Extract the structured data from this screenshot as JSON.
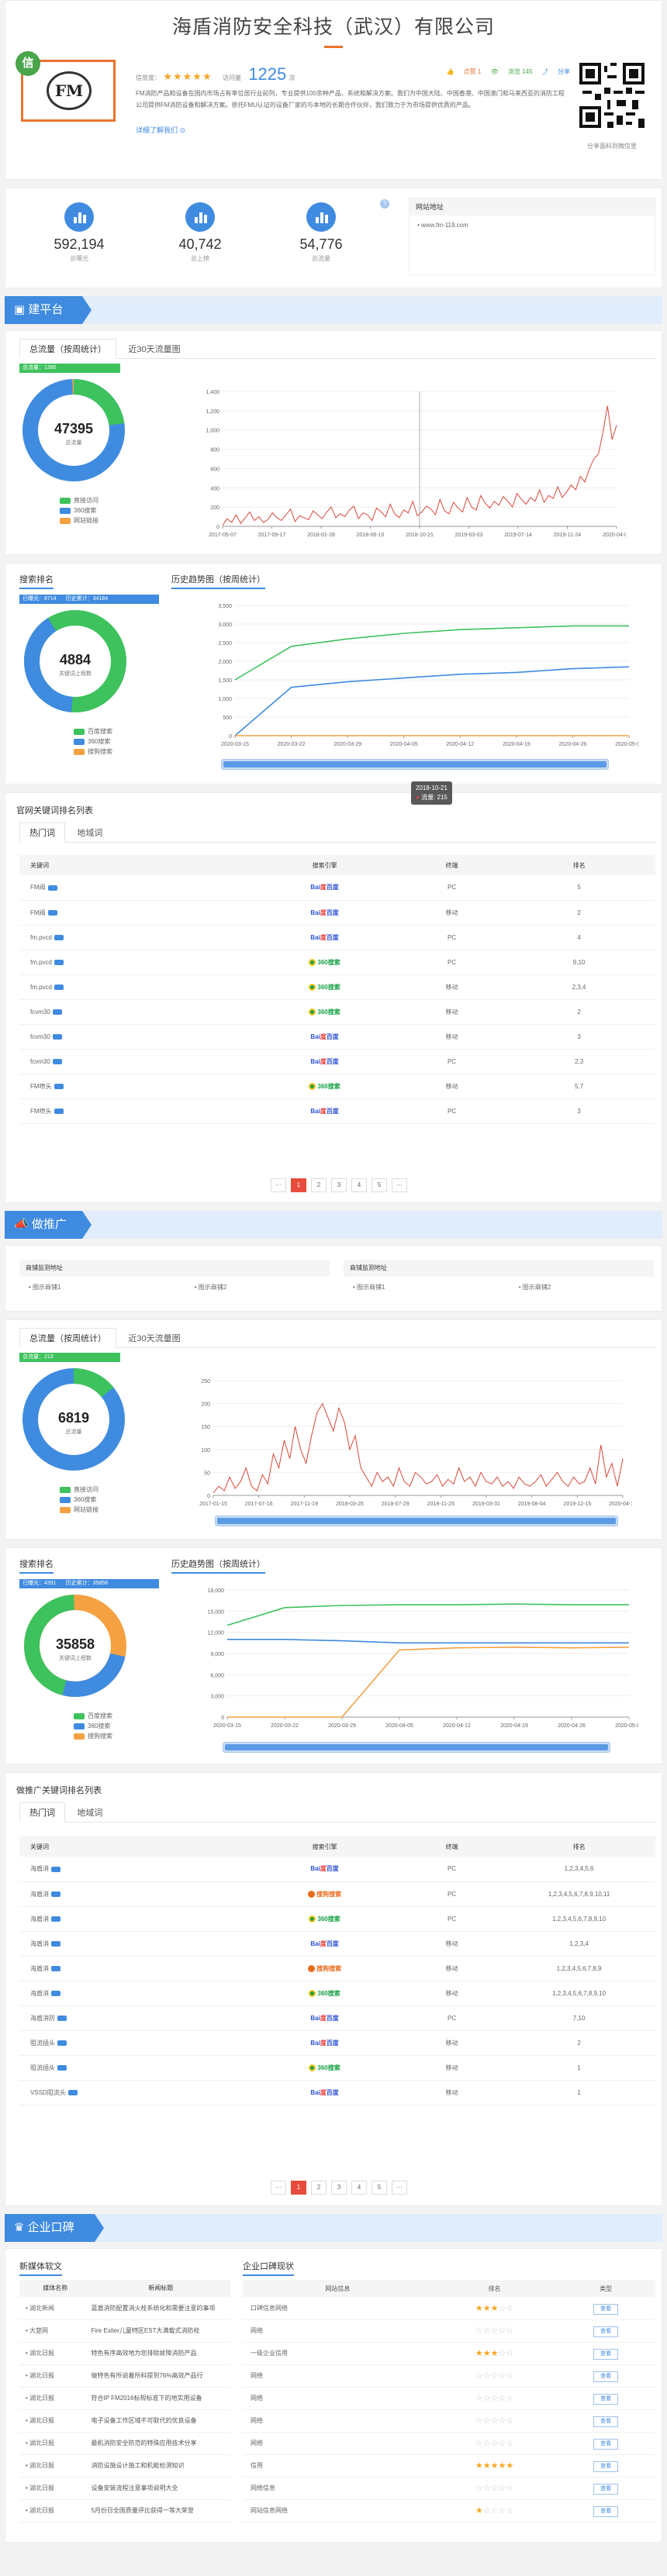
{
  "company": {
    "name": "海盾消防安全科技（武汉）有限公司",
    "logo_text": "FM",
    "verify_badge": "信",
    "reputation_label": "信誉度：",
    "stars": "★★★★★",
    "views_label": "访问量",
    "views_count": "1225",
    "views_unit": "次",
    "actions": [
      "点赞 1",
      "浏览 145",
      "分享"
    ],
    "description": "FM消防产品和设备在国内市场占有率位居行业前列，专业提供100余种产品、系统和解决方案。我们为中国大陆、中国香港、中国澳门和马来西亚的消防工程公司提供FM消防设备和解决方案。依托FMU认证的设备厂家的与本地的长期合作伙伴，我们致力于为市场提供优质的产品。",
    "detail_link": "详细了解我们",
    "qr_caption": "分享面料到微信里"
  },
  "stats": {
    "items": [
      {
        "value": "592,194",
        "caption": "总曝光"
      },
      {
        "value": "40,742",
        "caption": "总上榜"
      },
      {
        "value": "54,776",
        "caption": "总流量"
      }
    ],
    "help_icon": "?",
    "site_box_title": "网站地址",
    "site_url": "www.fm-119.com"
  },
  "section_jianpingtai": {
    "banner": "建平台",
    "tabs": [
      "总流量（按周统计）",
      "近30天流量图"
    ],
    "traffic_count_label": "总流量：",
    "traffic_count": "1390",
    "donut_value": "47395",
    "donut_caption": "总流量",
    "legend": [
      "直接访问",
      "360搜索",
      "网站链接"
    ],
    "tooltip_date": "2018-10-21",
    "tooltip_value": "流量: 215",
    "search_rank_title": "搜索排名",
    "history_title": "历史趋势图（按周统计）",
    "rank_counts": [
      "已曝光：8714",
      "历史累计：34184"
    ],
    "rank_donut_value": "4884",
    "rank_donut_caption": "关键词上榜数",
    "rank_legend": [
      "百度搜索",
      "360搜索",
      "搜狗搜索"
    ],
    "kw_table_title": "官网关键词排名列表",
    "kw_tabs": [
      "热门词",
      "地域词"
    ],
    "kw_headers": [
      "关键词",
      "搜索引擎",
      "终端",
      "排名"
    ],
    "kw_rows": [
      {
        "kw": "FM阀",
        "engine": "baidu",
        "term": "PC",
        "rank": "5"
      },
      {
        "kw": "FM阀",
        "engine": "baidu",
        "term": "移动",
        "rank": "2"
      },
      {
        "kw": "fm.pvcd",
        "engine": "baidu",
        "term": "PC",
        "rank": "4"
      },
      {
        "kw": "fm.pvcd",
        "engine": "360",
        "term": "PC",
        "rank": "9,10"
      },
      {
        "kw": "fm.pvcd",
        "engine": "360",
        "term": "移动",
        "rank": "2,3,4"
      },
      {
        "kw": "fcvm30",
        "engine": "360",
        "term": "移动",
        "rank": "2"
      },
      {
        "kw": "fcvm30",
        "engine": "baidu",
        "term": "移动",
        "rank": "3"
      },
      {
        "kw": "fcvm30",
        "engine": "baidu",
        "term": "PC",
        "rank": "2,3"
      },
      {
        "kw": "FM喷头",
        "engine": "360",
        "term": "移动",
        "rank": "5,7"
      },
      {
        "kw": "FM喷头",
        "engine": "baidu",
        "term": "PC",
        "rank": "3"
      }
    ],
    "pager": [
      "···",
      "1",
      "2",
      "3",
      "4",
      "5",
      "···"
    ]
  },
  "section_zuotuiguang": {
    "banner": "做推广",
    "box_titles": [
      "商铺监测地址",
      "商铺监测地址"
    ],
    "box_links": [
      [
        "图示商铺1",
        "图示商铺2"
      ],
      [
        "图示商铺1",
        "图示商铺2"
      ]
    ],
    "tabs": [
      "总流量（按周统计）",
      "近30天流量图"
    ],
    "traffic_count_label": "总流量：",
    "traffic_count": "213",
    "donut_value": "6819",
    "donut_caption": "总流量",
    "legend": [
      "直接访问",
      "360搜索",
      "网站链接"
    ],
    "search_rank_title": "搜索排名",
    "history_title": "历史趋势图（按周统计）",
    "rank_counts": [
      "已曝光：4391",
      "历史累计：35858"
    ],
    "rank_donut_value": "35858",
    "rank_donut_caption": "关键词上榜数",
    "rank_legend": [
      "百度搜索",
      "360搜索",
      "搜狗搜索"
    ],
    "kw_table_title": "做推广关键词排名列表",
    "kw_tabs": [
      "热门词",
      "地域词"
    ],
    "kw_headers": [
      "关键词",
      "搜索引擎",
      "终端",
      "排名"
    ],
    "kw_rows": [
      {
        "kw": "海盾消",
        "engine": "baidu",
        "term": "PC",
        "rank": "1,2,3,4,5,6"
      },
      {
        "kw": "海盾消",
        "engine": "sogou",
        "term": "PC",
        "rank": "1,2,3,4,5,6,7,8,9,10,11"
      },
      {
        "kw": "海盾消",
        "engine": "360",
        "term": "PC",
        "rank": "1,2,3,4,5,6,7,8,9,10"
      },
      {
        "kw": "海盾消",
        "engine": "baidu",
        "term": "移动",
        "rank": "1,2,3,4"
      },
      {
        "kw": "海盾消",
        "engine": "sogou",
        "term": "移动",
        "rank": "1,2,3,4,5,6,7,8,9"
      },
      {
        "kw": "海盾消",
        "engine": "360",
        "term": "移动",
        "rank": "1,2,3,4,5,6,7,8,9,10"
      },
      {
        "kw": "海盾消防",
        "engine": "baidu",
        "term": "PC",
        "rank": "7,10"
      },
      {
        "kw": "阻流插头",
        "engine": "baidu",
        "term": "移动",
        "rank": "2"
      },
      {
        "kw": "阻流插头",
        "engine": "360",
        "term": "移动",
        "rank": "1"
      },
      {
        "kw": "VSSD阻流头",
        "engine": "baidu",
        "term": "移动",
        "rank": "1"
      }
    ],
    "pager": [
      "···",
      "1",
      "2",
      "3",
      "4",
      "5",
      "···"
    ]
  },
  "section_koubei": {
    "banner": "企业口碑",
    "news_title": "新媒体软文",
    "news_headers": [
      "媒体名称",
      "新闻标题"
    ],
    "news_rows": [
      {
        "media": "湖北新闻",
        "title": "蓝盾消防配置消火栓系统化和需要注意的事项"
      },
      {
        "media": "大楚网",
        "title": "Fire Exiter儿童特区EST大满载式消防栓"
      },
      {
        "media": "湖北日报",
        "title": "特色有序高效地为您排除故障消防产品"
      },
      {
        "media": "湖北日报",
        "title": "做特色有所说着所料提到76%高效产品行"
      },
      {
        "media": "湖北日报",
        "title": "符合IP FM2016标规标准下的地实用设备"
      },
      {
        "media": "湖北日报",
        "title": "电子设备工作区域不可取代的优良设备"
      },
      {
        "media": "湖北日报",
        "title": "最机消防安全防范的特殊应用技术分享"
      },
      {
        "media": "湖北日报",
        "title": "消防设施设计施工和机能检测知识"
      },
      {
        "media": "湖北日报",
        "title": "设备安装流程注意事项说明大全"
      },
      {
        "media": "湖北日报",
        "title": "5月份日全国质量评比获得一等大荣誉"
      }
    ],
    "reputation_title": "企业口碑现状",
    "rep_headers": [
      "网站信息",
      "排名",
      "类型"
    ],
    "rep_rows": [
      {
        "site": "口碑信息网络",
        "stars": 3,
        "btn": "查看"
      },
      {
        "site": "网络",
        "stars": 0,
        "btn": "查看"
      },
      {
        "site": "一级企业信用",
        "stars": 3,
        "btn": "查看"
      },
      {
        "site": "网络",
        "stars": 0,
        "btn": "查看"
      },
      {
        "site": "网络",
        "stars": 0,
        "btn": "查看"
      },
      {
        "site": "网络",
        "stars": 0,
        "btn": "查看"
      },
      {
        "site": "网络",
        "stars": 0,
        "btn": "查看"
      },
      {
        "site": "信用",
        "stars": 5,
        "btn": "查看"
      },
      {
        "site": "网络信息",
        "stars": 0,
        "btn": "查看"
      },
      {
        "site": "网站信息网络",
        "stars": 1,
        "btn": "查看"
      }
    ]
  },
  "colors": {
    "accent": "#3f8be0",
    "green": "#3ec25d",
    "orange": "#f5a142",
    "red_line": "#d8473a"
  },
  "chart_data": [
    {
      "type": "line",
      "title": "",
      "series_color": "#d8473a",
      "x_ticks": [
        "2017-05-07",
        "2017-09-17",
        "2018-01-28",
        "2018-06-10",
        "2018-10-21",
        "2019-03-03",
        "2019-07-14",
        "2019-11-24",
        "2020-04-05"
      ],
      "ylim": [
        0,
        1400
      ],
      "y_ticks": [
        0,
        200,
        400,
        600,
        800,
        1000,
        1200,
        1400
      ],
      "values": [
        10,
        80,
        40,
        120,
        30,
        90,
        150,
        60,
        100,
        40,
        70,
        140,
        90,
        60,
        120,
        180,
        50,
        110,
        90,
        70,
        160,
        120,
        80,
        150,
        200,
        90,
        130,
        100,
        170,
        210,
        80,
        140,
        120,
        60,
        190,
        150,
        100,
        230,
        130,
        90,
        170,
        140,
        260,
        110,
        150,
        210,
        180,
        120,
        280,
        160,
        130,
        250,
        190,
        150,
        300,
        200,
        170,
        320,
        240,
        190,
        260,
        220,
        310,
        260,
        200,
        340,
        280,
        230,
        300,
        260,
        380,
        250,
        320,
        290,
        410,
        300,
        360,
        430,
        380,
        520,
        460,
        600,
        700,
        750,
        980,
        1250,
        900,
        1050
      ],
      "tooltip": {
        "date": "2018-10-21",
        "value": 215
      }
    },
    {
      "type": "line",
      "x_ticks": [
        "2020-03-15",
        "2020-03-22",
        "2020-03-29",
        "2020-04-05",
        "2020-04-12",
        "2020-04-19",
        "2020-04-26",
        "2020-05-03"
      ],
      "ylim": [
        0,
        3500
      ],
      "y_ticks": [
        0,
        500,
        1000,
        1500,
        2000,
        2500,
        3000,
        3500
      ],
      "series": [
        {
          "name": "百度搜索",
          "color": "#3ec25d",
          "values": [
            1500,
            2400,
            2600,
            2750,
            2850,
            2900,
            2950,
            2950
          ]
        },
        {
          "name": "360搜索",
          "color": "#3f8be0",
          "values": [
            0,
            1300,
            1450,
            1550,
            1650,
            1700,
            1800,
            1850
          ]
        },
        {
          "name": "搜狗搜索",
          "color": "#f5a142",
          "values": [
            0,
            0,
            0,
            0,
            0,
            0,
            0,
            0
          ]
        }
      ]
    },
    {
      "type": "line",
      "series_color": "#d8473a",
      "x_ticks": [
        "2017-01-15",
        "2017-07-16",
        "2017-11-19",
        "2018-03-25",
        "2018-07-29",
        "2018-11-25",
        "2019-03-31",
        "2019-08-04",
        "2019-12-15",
        "2020-04-19"
      ],
      "ylim": [
        0,
        250
      ],
      "y_ticks": [
        0,
        50,
        100,
        150,
        200,
        250
      ],
      "values": [
        5,
        20,
        10,
        40,
        15,
        30,
        60,
        20,
        10,
        45,
        25,
        90,
        60,
        120,
        80,
        150,
        100,
        70,
        130,
        180,
        200,
        170,
        140,
        190,
        160,
        100,
        130,
        60,
        40,
        20,
        50,
        30,
        40,
        20,
        60,
        30,
        20,
        50,
        40,
        25,
        30,
        45,
        20,
        35,
        25,
        60,
        30,
        40,
        20,
        50,
        30,
        25,
        40,
        20,
        30,
        15,
        40,
        25,
        20,
        30,
        45,
        20,
        35,
        50,
        30,
        20,
        40,
        25,
        30,
        60,
        25,
        110,
        40,
        70,
        20,
        80
      ]
    },
    {
      "type": "line",
      "x_ticks": [
        "2020-03-15",
        "2020-03-22",
        "2020-03-29",
        "2020-04-05",
        "2020-04-12",
        "2020-04-19",
        "2020-04-26",
        "2020-05-03"
      ],
      "ylim": [
        0,
        18000
      ],
      "y_ticks": [
        0,
        3000,
        6000,
        9000,
        12000,
        15000,
        18000
      ],
      "series": [
        {
          "name": "百度搜索",
          "color": "#3ec25d",
          "values": [
            13000,
            15500,
            15800,
            15900,
            15900,
            16000,
            15900,
            15900
          ]
        },
        {
          "name": "360搜索",
          "color": "#3f8be0",
          "values": [
            11000,
            11000,
            10800,
            10500,
            10500,
            10500,
            10500,
            10500
          ]
        },
        {
          "name": "搜狗搜索",
          "color": "#f5a142",
          "values": [
            0,
            0,
            0,
            9500,
            9800,
            9900,
            9800,
            9900
          ]
        }
      ]
    }
  ]
}
